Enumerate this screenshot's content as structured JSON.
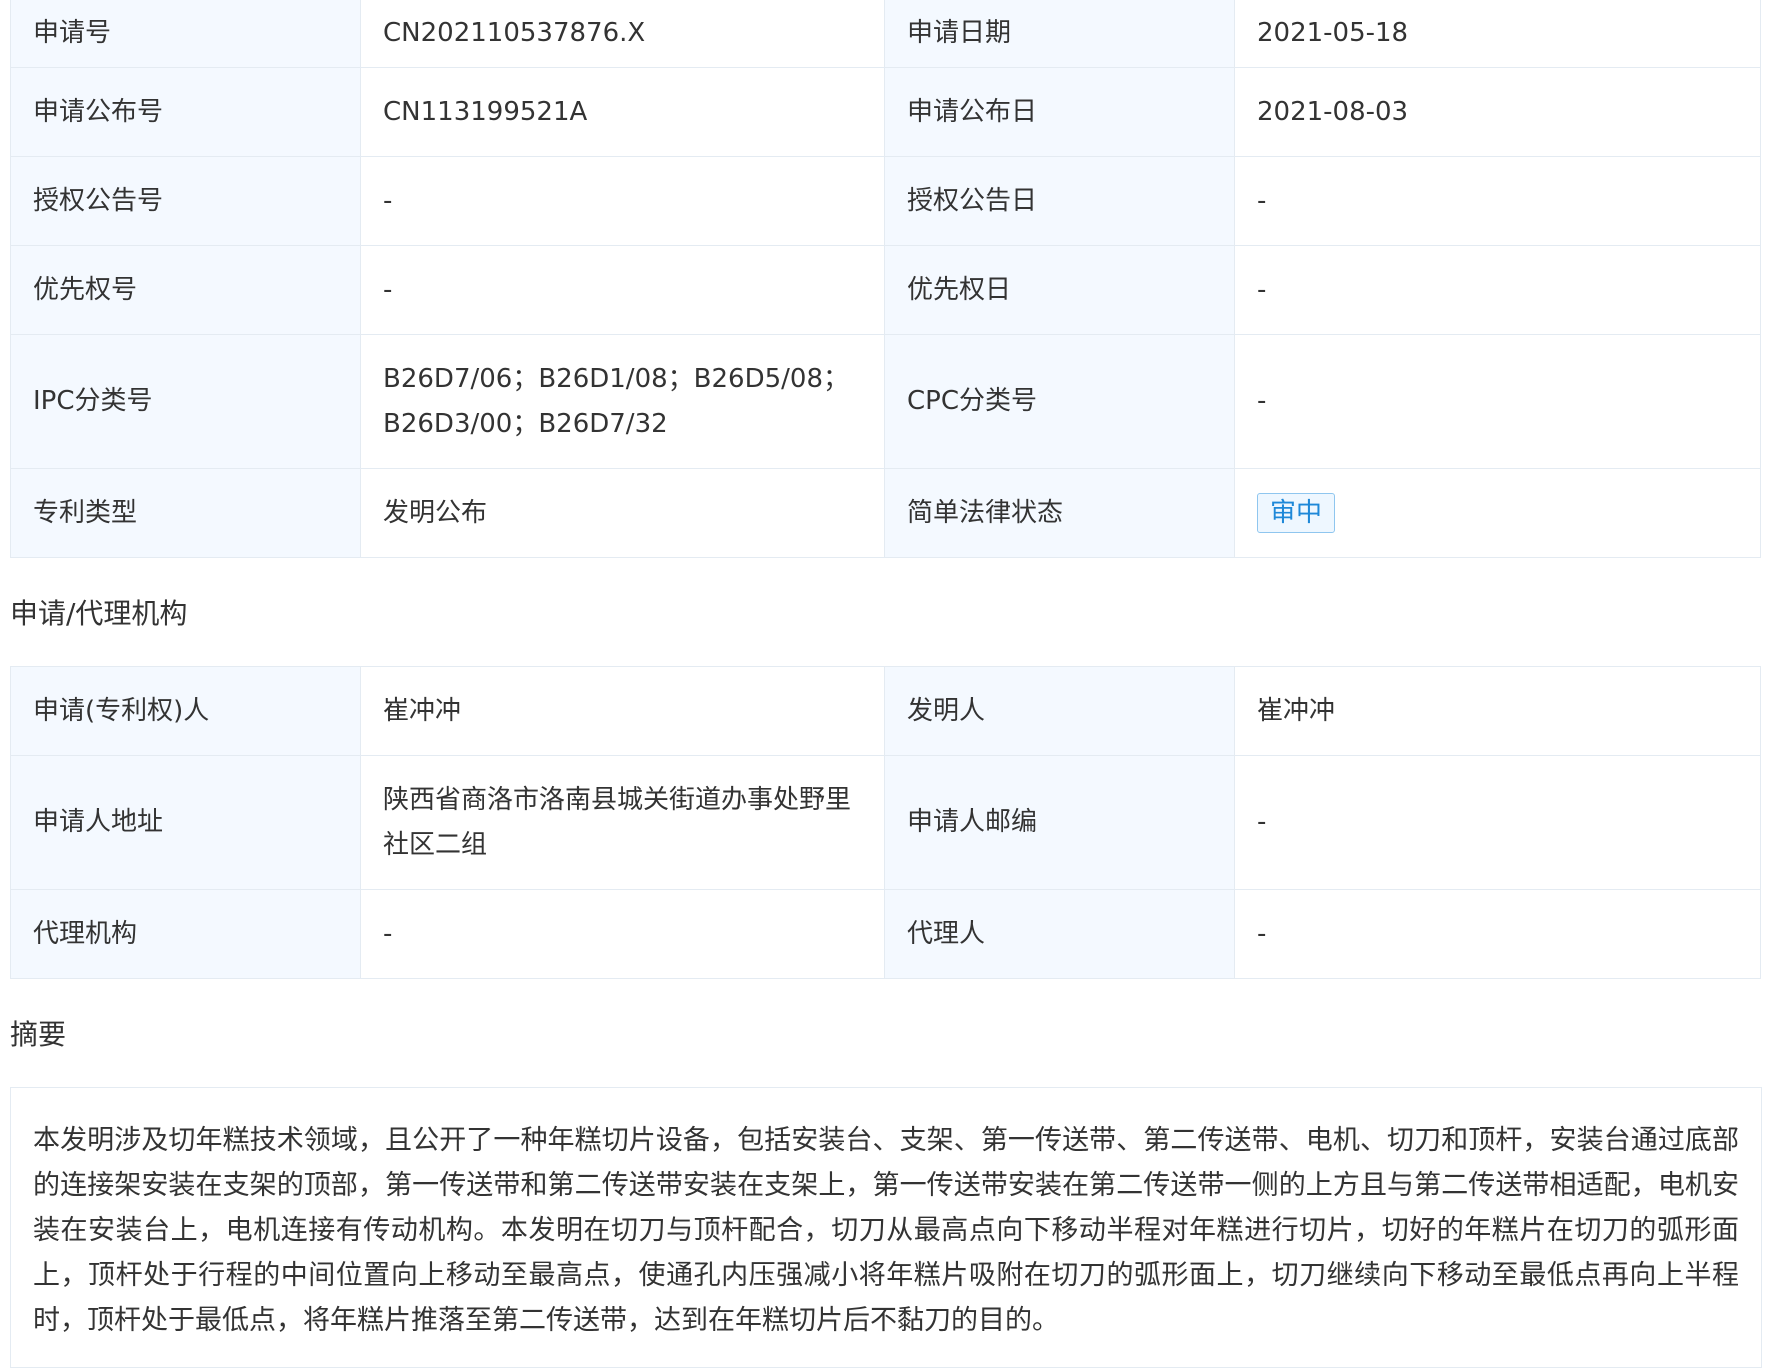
{
  "basic_info": {
    "rows": [
      {
        "k1": "申请号",
        "v1": "CN202110537876.X",
        "k2": "申请日期",
        "v2": "2021-05-18"
      },
      {
        "k1": "申请公布号",
        "v1": "CN113199521A",
        "k2": "申请公布日",
        "v2": "2021-08-03"
      },
      {
        "k1": "授权公告号",
        "v1": "-",
        "k2": "授权公告日",
        "v2": "-"
      },
      {
        "k1": "优先权号",
        "v1": "-",
        "k2": "优先权日",
        "v2": "-"
      },
      {
        "k1": "IPC分类号",
        "v1": "B26D7/06；B26D1/08；B26D5/08；B26D3/00；B26D7/32",
        "k2": "CPC分类号",
        "v2": "-"
      },
      {
        "k1": "专利类型",
        "v1": "发明公布",
        "k2": "简单法律状态",
        "v2": "审中"
      }
    ]
  },
  "applicant_section": {
    "title": "申请/代理机构",
    "rows": [
      {
        "k1": "申请(专利权)人",
        "v1": "崔冲冲",
        "k2": "发明人",
        "v2": "崔冲冲"
      },
      {
        "k1": "申请人地址",
        "v1": "陕西省商洛市洛南县城关街道办事处野里社区二组",
        "k2": "申请人邮编",
        "v2": "-"
      },
      {
        "k1": "代理机构",
        "v1": "-",
        "k2": "代理人",
        "v2": "-"
      }
    ]
  },
  "abstract_section": {
    "title": "摘要",
    "text": "本发明涉及切年糕技术领域，且公开了一种年糕切片设备，包括安装台、支架、第一传送带、第二传送带、电机、切刀和顶杆，安装台通过底部的连接架安装在支架的顶部，第一传送带和第二传送带安装在支架上，第一传送带安装在第二传送带一侧的上方且与第二传送带相适配，电机安装在安装台上，电机连接有传动机构。本发明在切刀与顶杆配合，切刀从最高点向下移动半程对年糕进行切片，切好的年糕片在切刀的弧形面上，顶杆处于行程的中间位置向上移动至最高点，使通孔内压强减小将年糕片吸附在切刀的弧形面上，切刀继续向下移动至最低点再向上半程时，顶杆处于最低点，将年糕片推落至第二传送带，达到在年糕切片后不黏刀的目的。"
  },
  "colors": {
    "label_bg": "#f4f9ff",
    "border": "#e4ebf2",
    "badge_text": "#1e88d8",
    "badge_border": "#8fc6ef"
  }
}
